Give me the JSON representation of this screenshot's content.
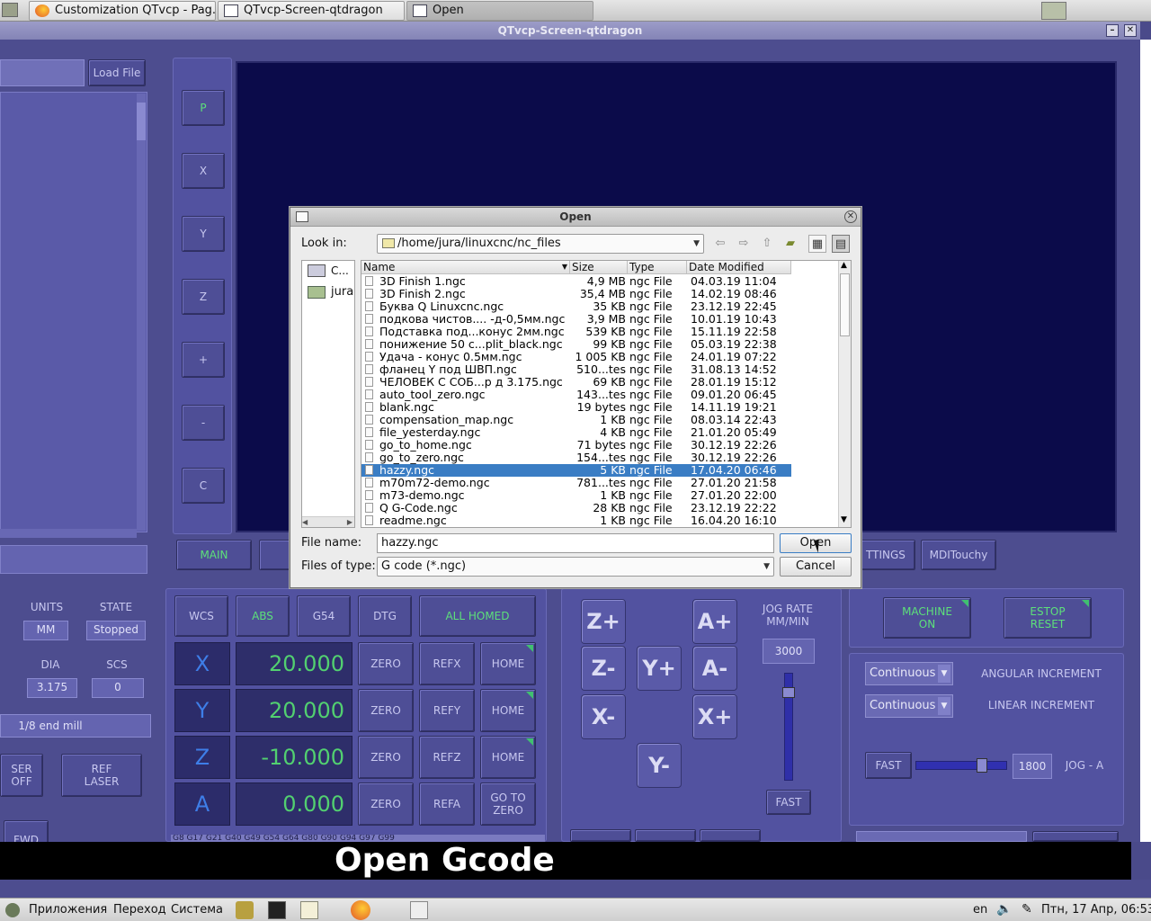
{
  "taskbar": {
    "tabs": [
      "Customization QTvcp - Pag...",
      "QTvcp-Screen-qtdragon",
      "Open"
    ]
  },
  "window": {
    "title": "QTvcp-Screen-qtdragon"
  },
  "left": {
    "load_file": "Load File",
    "units_label": "UNITS",
    "state_label": "STATE",
    "units": "MM",
    "state": "Stopped",
    "dia_label": "DIA",
    "scs_label": "SCS",
    "dia": "3.175",
    "scs": "0",
    "tool_desc": "1/8 end mill",
    "laser_off": "SER\nOFF",
    "ref_laser": "REF\nLASER",
    "fwd": "FWD"
  },
  "side_buttons": [
    "P",
    "X",
    "Y",
    "Z",
    "+",
    "-",
    "C"
  ],
  "tabs": {
    "main": "MAIN",
    "settings": "TTINGS",
    "mdi": "MDITouchy"
  },
  "dro": {
    "wcs": "WCS",
    "abs": "ABS",
    "g54": "G54",
    "dtg": "DTG",
    "all_homed": "ALL HOMED",
    "zero": "ZERO",
    "home": "HOME",
    "goto_zero": "GO TO\nZERO",
    "axes": [
      {
        "name": "X",
        "value": "20.000",
        "ref": "REFX"
      },
      {
        "name": "Y",
        "value": "20.000",
        "ref": "REFY"
      },
      {
        "name": "Z",
        "value": "-10.000",
        "ref": "REFZ"
      },
      {
        "name": "A",
        "value": "0.000",
        "ref": "REFA"
      }
    ],
    "gcodes": "G8 G17 G21 G40 G49 G54 G64 G80 G90 G94 G97 G99"
  },
  "jog": {
    "zp": "Z+",
    "zm": "Z-",
    "yp": "Y+",
    "ym": "Y-",
    "xp": "X+",
    "xm": "X-",
    "ap": "A+",
    "am": "A-",
    "rate_label": "JOG RATE\nMM/MIN",
    "rate": "3000",
    "fast": "FAST"
  },
  "right": {
    "machine_on": "MACHINE\nON",
    "estop": "ESTOP\nRESET",
    "angular_mode": "Continuous",
    "angular_label": "ANGULAR INCREMENT",
    "linear_mode": "Continuous",
    "linear_label": "LINEAR INCREMENT",
    "fast": "FAST",
    "jog_a_value": "1800",
    "jog_a_label": "JOG - A"
  },
  "dialog": {
    "title": "Open",
    "look_in_label": "Look in:",
    "look_in": "/home/jura/linuxcnc/nc_files",
    "places": [
      "C...",
      "jura"
    ],
    "columns": [
      "Name",
      "Size",
      "Type",
      "Date Modified"
    ],
    "files": [
      [
        "3D Finish 1.ngc",
        "4,9 MB",
        "ngc File",
        "04.03.19 11:04"
      ],
      [
        "3D Finish 2.ngc",
        "35,4 MB",
        "ngc File",
        "14.02.19 08:46"
      ],
      [
        "Буква Q Linuxcnc.ngc",
        "35 KB",
        "ngc File",
        "23.12.19 22:45"
      ],
      [
        "подкова чистов.... -д-0,5мм.ngc",
        "3,9 MB",
        "ngc File",
        "10.01.19 10:43"
      ],
      [
        "Подставка под...конус 2мм.ngc",
        "539 KB",
        "ngc File",
        "15.11.19 22:58"
      ],
      [
        "понижение 50 с...plit_black.ngc",
        "99 KB",
        "ngc File",
        "05.03.19 22:38"
      ],
      [
        "Удача - конус 0.5мм.ngc",
        "1 005 KB",
        "ngc File",
        "24.01.19 07:22"
      ],
      [
        "фланец Y под ШВП.ngc",
        "510...tes",
        "ngc File",
        "31.08.13 14:52"
      ],
      [
        "ЧЕЛОВЕК С СОБ...р д 3.175.ngc",
        "69 KB",
        "ngc File",
        "28.01.19 15:12"
      ],
      [
        "auto_tool_zero.ngc",
        "143...tes",
        "ngc File",
        "09.01.20 06:45"
      ],
      [
        "blank.ngc",
        "19 bytes",
        "ngc File",
        "14.11.19 19:21"
      ],
      [
        "compensation_map.ngc",
        "1 KB",
        "ngc File",
        "08.03.14 22:43"
      ],
      [
        "file_yesterday.ngc",
        "4 KB",
        "ngc File",
        "21.01.20 05:49"
      ],
      [
        "go_to_home.ngc",
        "71 bytes",
        "ngc File",
        "30.12.19 22:26"
      ],
      [
        "go_to_zero.ngc",
        "154...tes",
        "ngc File",
        "30.12.19 22:26"
      ],
      [
        "hazzy.ngc",
        "5 KB",
        "ngc File",
        "17.04.20 06:46"
      ],
      [
        "m70m72-demo.ngc",
        "781...tes",
        "ngc File",
        "27.01.20 21:58"
      ],
      [
        "m73-demo.ngc",
        "1 KB",
        "ngc File",
        "27.01.20 22:00"
      ],
      [
        "Q G-Code.ngc",
        "28 KB",
        "ngc File",
        "23.12.19 22:22"
      ],
      [
        "readme.ngc",
        "1 KB",
        "ngc File",
        "16.04.20 16:10"
      ]
    ],
    "selected_index": 15,
    "file_name_label": "File name:",
    "file_name": "hazzy.ngc",
    "types_label": "Files of type:",
    "file_type": "G code (*.ngc)",
    "open": "Open",
    "cancel": "Cancel"
  },
  "caption": "Open Gcode",
  "bottom": {
    "apps": "Приложения",
    "go": "Переход",
    "system": "Система",
    "lang": "en",
    "clock": "Птн, 17 Апр, 06:53"
  }
}
